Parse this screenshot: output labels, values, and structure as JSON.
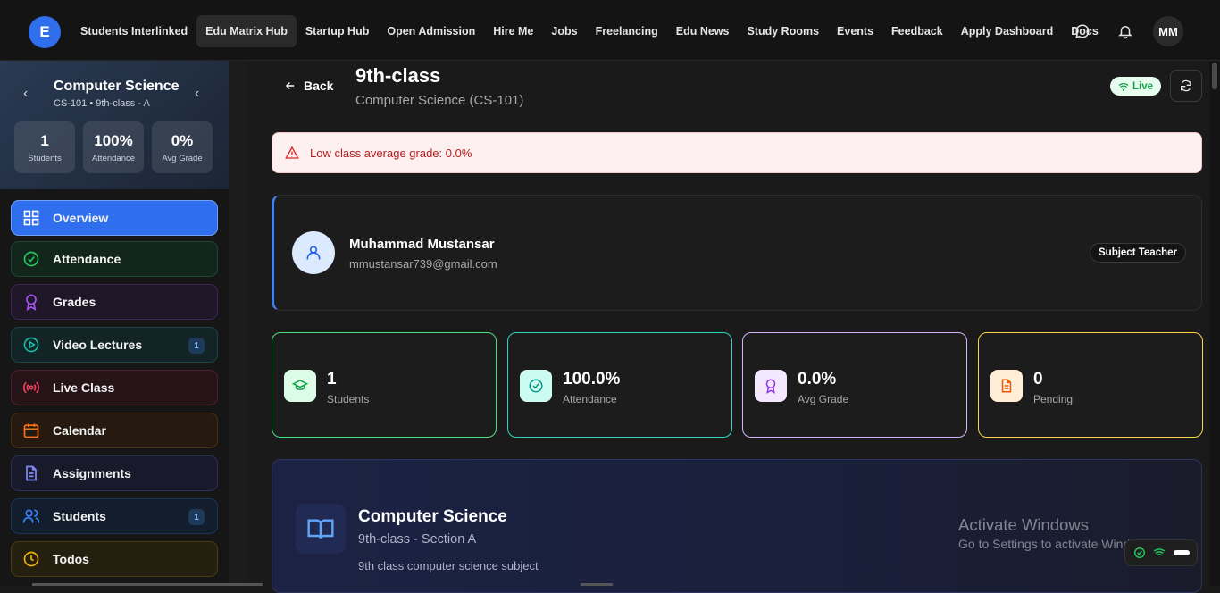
{
  "topnav": {
    "logo_letter": "E",
    "links": [
      "Students Interlinked",
      "Edu Matrix Hub",
      "Startup Hub",
      "Open Admission",
      "Hire Me",
      "Jobs",
      "Freelancing",
      "Edu News",
      "Study Rooms",
      "Events",
      "Feedback",
      "Apply Dashboard",
      "Docs"
    ],
    "active_link": "Edu Matrix Hub",
    "icons": [
      "message-icon",
      "bell-icon"
    ],
    "avatar_initials": "MM"
  },
  "sidebar": {
    "course_title": "Computer Science",
    "course_sub": "CS-101 • 9th-class - A",
    "stats": [
      {
        "value": "1",
        "label": "Students"
      },
      {
        "value": "100%",
        "label": "Attendance"
      },
      {
        "value": "0%",
        "label": "Avg Grade"
      }
    ],
    "items": [
      {
        "label": "Overview",
        "icon": "grid-icon",
        "color": "#3b82f6",
        "active": true
      },
      {
        "label": "Attendance",
        "icon": "check-circle-icon",
        "color": "#22c55e"
      },
      {
        "label": "Grades",
        "icon": "award-icon",
        "color": "#a855f7"
      },
      {
        "label": "Video Lectures",
        "icon": "play-icon",
        "color": "#14b8a6",
        "badge": "1"
      },
      {
        "label": "Live Class",
        "icon": "broadcast-icon",
        "color": "#f43f5e"
      },
      {
        "label": "Calendar",
        "icon": "calendar-icon",
        "color": "#f97316"
      },
      {
        "label": "Assignments",
        "icon": "file-icon",
        "color": "#818cf8"
      },
      {
        "label": "Students",
        "icon": "users-icon",
        "color": "#3b82f6",
        "badge": "1"
      },
      {
        "label": "Todos",
        "icon": "clock-icon",
        "color": "#eab308"
      }
    ]
  },
  "header": {
    "back_label": "Back",
    "title": "9th-class",
    "subtitle": "Computer Science (CS-101)",
    "live_label": "Live"
  },
  "alert": {
    "text": "Low class average grade: 0.0%"
  },
  "teacher": {
    "name": "Muhammad Mustansar",
    "email": "mmustansar739@gmail.com",
    "role": "Subject Teacher"
  },
  "stats": [
    {
      "value": "1",
      "label": "Students",
      "icon": "graduation-cap-icon",
      "accent": "#22c55e"
    },
    {
      "value": "100.0%",
      "label": "Attendance",
      "icon": "check-circle-icon",
      "accent": "#14b8a6"
    },
    {
      "value": "0.0%",
      "label": "Avg Grade",
      "icon": "award-icon",
      "accent": "#a855f7"
    },
    {
      "value": "0",
      "label": "Pending",
      "icon": "file-icon",
      "accent": "#f59e0b"
    }
  ],
  "subject": {
    "title": "Computer Science",
    "sub": "9th-class - Section A",
    "desc": "9th class computer science subject"
  },
  "watermark": {
    "line1": "Activate Windows",
    "line2": "Go to Settings to activate Windows."
  }
}
